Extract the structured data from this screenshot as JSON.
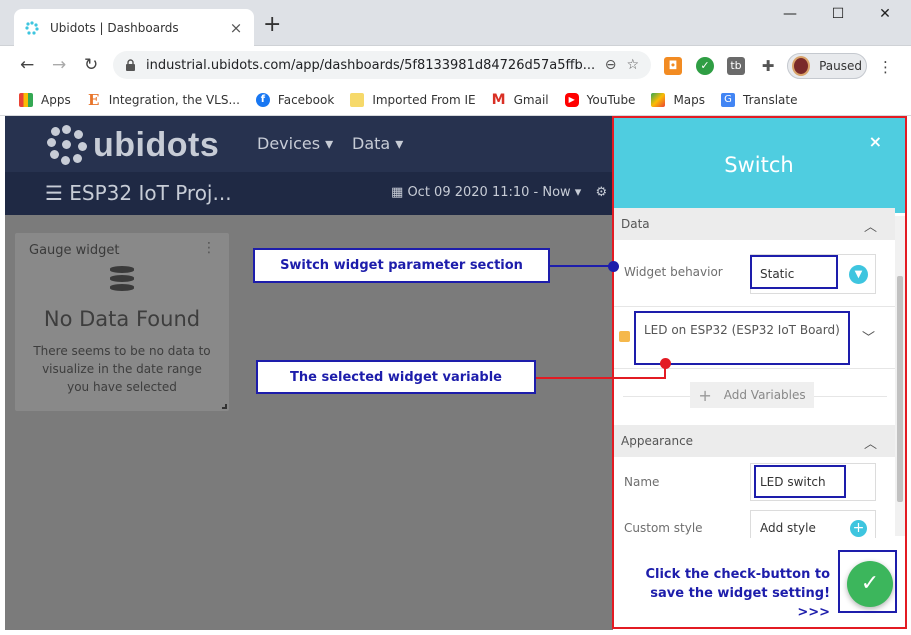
{
  "browser": {
    "tab_title": "Ubidots | Dashboards",
    "tab_close": "×",
    "new_tab": "+",
    "window_controls": {
      "minimize": "—",
      "maximize": "☐",
      "close": "✕"
    },
    "url": "industrial.ubidots.com/app/dashboards/5f8133981d84726d57a5ffb...",
    "profile_label": "Paused",
    "bookmarks": [
      "Apps",
      "Integration, the VLS...",
      "Facebook",
      "Imported From IE",
      "Gmail",
      "YouTube",
      "Maps",
      "Translate"
    ]
  },
  "app": {
    "logo_text": "ubidots",
    "nav": {
      "devices": "Devices ▾",
      "data": "Data ▾"
    },
    "dashboard_title": "☰ ESP32 IoT Proj...",
    "date_range": "Oct 09 2020 11:10 - Now ▾",
    "gauge_widget": {
      "title": "Gauge widget",
      "empty_title": "No Data Found",
      "empty_message": "There seems to be no data to visualize in the date range you have selected"
    }
  },
  "panel": {
    "title": "Switch",
    "close": "×",
    "data_section": "Data",
    "widget_behavior_label": "Widget behavior",
    "widget_behavior_value": "Static",
    "variable_name": "LED on ESP32 (ESP32 IoT Board)",
    "add_variables": "Add Variables",
    "appearance_section": "Appearance",
    "name_label": "Name",
    "name_value": "LED switch",
    "custom_style_label": "Custom style",
    "custom_style_value": "Add style"
  },
  "annotations": {
    "param_section": "Switch widget parameter section",
    "selected_variable": "The selected widget variable",
    "save_hint": "Click the check-button to save the widget setting! >>>"
  },
  "colors": {
    "navbar": "#27324f",
    "panel_header": "#4fcde0",
    "save_button": "#3cb65c",
    "annotation_blue": "#1d1dab",
    "annotation_red": "#e31b23"
  }
}
